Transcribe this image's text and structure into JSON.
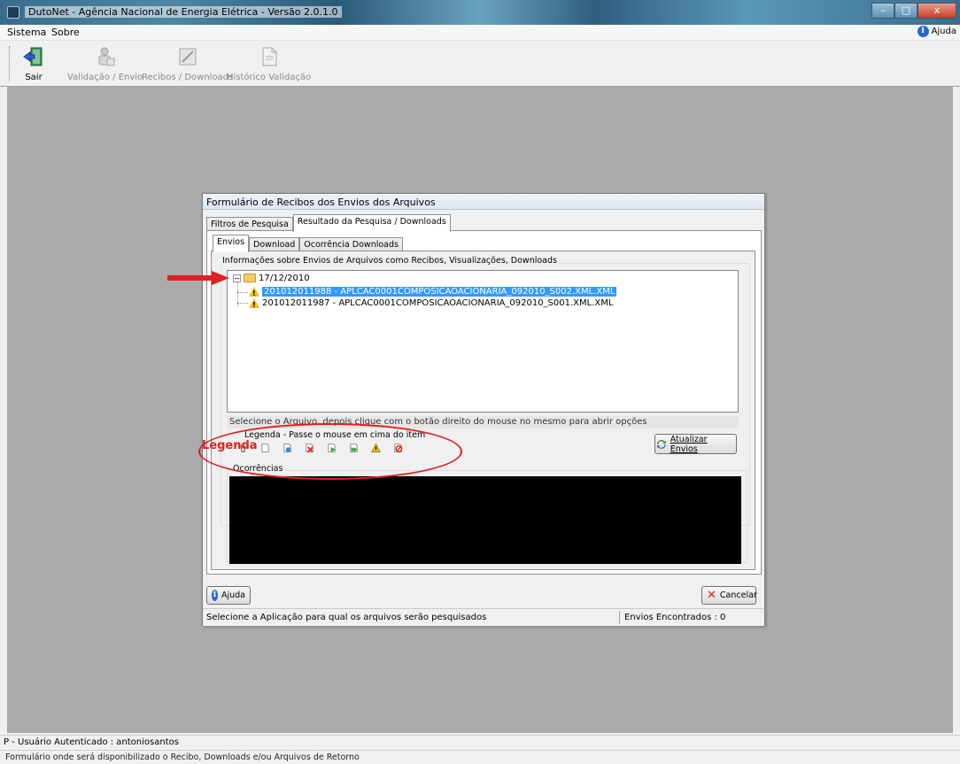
{
  "window": {
    "title": "DutoNet - Agência Nacional de Energia Elétrica - Versão 2.0.1.0",
    "min_label": "–",
    "max_label": "□",
    "close_label": "x"
  },
  "menu": {
    "items": [
      "Sistema",
      "Sobre"
    ],
    "help_label": "Ajuda"
  },
  "toolbar": {
    "buttons": [
      {
        "label": "Sair",
        "enabled": true
      },
      {
        "label": "Validação / Envio",
        "enabled": false
      },
      {
        "label": "Recibos / Downloads",
        "enabled": false
      },
      {
        "label": "Histórico Validação",
        "enabled": false
      }
    ]
  },
  "dialog": {
    "title": "Formulário de Recibos dos Envios dos Arquivos",
    "outer_tabs": [
      "Filtros de Pesquisa",
      "Resultado da Pesquisa / Downloads"
    ],
    "inner_tabs": [
      "Envios",
      "Download",
      "Ocorrência Downloads"
    ],
    "group_label": "Informações sobre Envios de Arquivos como Recibos, Visualizações, Downloads",
    "tree": {
      "date_node": "17/12/2010",
      "files": [
        {
          "name": "201012011988 - APLCAC0001COMPOSICAOACIONARIA_092010_S002.XML.XML",
          "selected": true
        },
        {
          "name": "201012011987 - APLCAC0001COMPOSICAOACIONARIA_092010_S001.XML.XML",
          "selected": false
        }
      ]
    },
    "hint": "Selecione o Arquivo, depois clique com o botão direito do mouse no mesmo para abrir opções",
    "legend_title": "Legenda - Passe o mouse em cima do item",
    "legend_icons": [
      "clip-icon",
      "document-icon",
      "refresh-icon",
      "delete-icon",
      "download-icon",
      "download-multi-icon",
      "warning-icon",
      "blocked-icon"
    ],
    "update_button": "Atualizar Envios",
    "occurrences_label": "Ocorrências",
    "help_button": "Ajuda",
    "cancel_button": "Cancelar",
    "status_left": "Selecione a Aplicação para qual os arquivos serão pesquisados",
    "status_right": "Envios Encontrados : 0"
  },
  "annotations": {
    "legend_callout": "Legenda",
    "color": "#e02020"
  },
  "status": {
    "line1": "P - Usuário Autenticado : antoniosantos",
    "line2": "Formulário onde será disponibilizado o Recibo, Downloads  e/ou Arquivos de Retorno"
  },
  "colors": {
    "selection": "#3399ff",
    "mdi_background": "#ababab",
    "occurrences_background": "#000000"
  }
}
